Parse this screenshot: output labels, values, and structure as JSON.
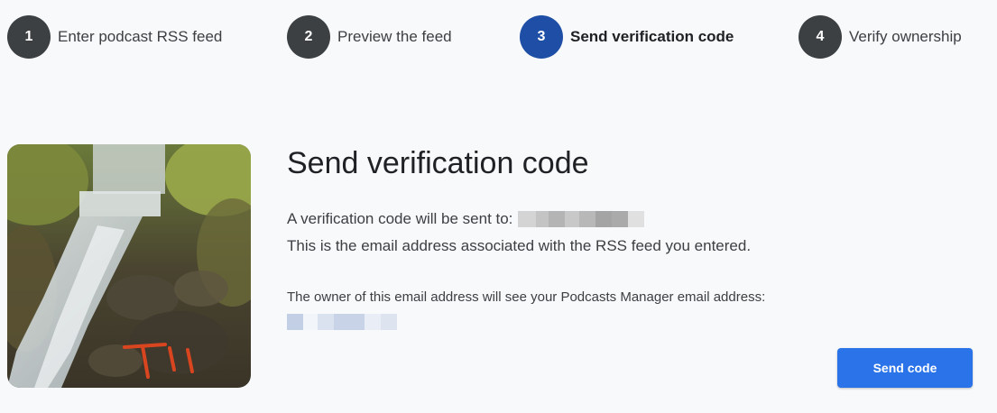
{
  "stepper": {
    "steps": [
      {
        "number": "1",
        "label": "Enter podcast RSS feed",
        "active": false
      },
      {
        "number": "2",
        "label": "Preview the feed",
        "active": false
      },
      {
        "number": "3",
        "label": "Send verification code",
        "active": true
      },
      {
        "number": "4",
        "label": "Verify ownership",
        "active": false
      }
    ],
    "active_color": "#1f4ea6",
    "inactive_color": "#3c4043"
  },
  "main": {
    "title": "Send verification code",
    "sent_to_text": "A verification code will be sent to:",
    "association_text": "This is the email address associated with the RSS feed you entered.",
    "owner_note": "The owner of this email address will see your Podcasts Manager email address:",
    "send_button_label": "Send code"
  },
  "colors": {
    "accent": "#2a73e8",
    "background": "#f8f9fa"
  }
}
